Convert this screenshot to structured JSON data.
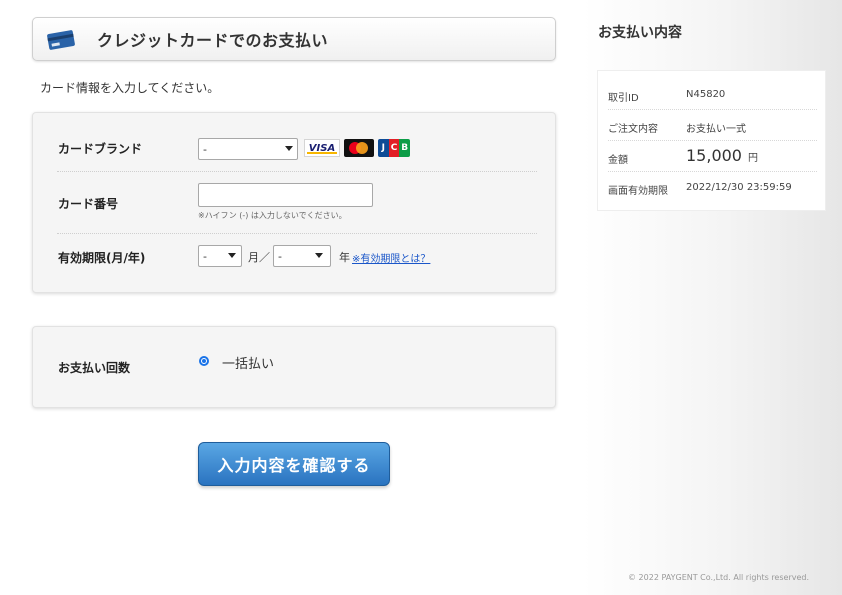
{
  "header": {
    "title": "クレジットカードでのお支払い"
  },
  "instructions": "カード情報を入力してください。",
  "form": {
    "card_brand": {
      "label": "カードブランド",
      "selected": "-"
    },
    "card_number": {
      "label": "カード番号",
      "value": "",
      "hint": "※ハイフン (-) は入力しないでください。"
    },
    "expiry": {
      "label": "有効期限(月/年)",
      "month_selected": "-",
      "month_unit": "月／",
      "year_selected": "-",
      "year_unit": "年",
      "help_link": "※有効期限とは？"
    },
    "installments": {
      "label": "お支払い回数",
      "option_label": "一括払い",
      "selected": true
    },
    "submit_label": "入力内容を確認する"
  },
  "brands": {
    "visa": "VISA",
    "jcb": [
      "J",
      "C",
      "B"
    ]
  },
  "summary": {
    "title": "お支払い内容",
    "rows": [
      {
        "label": "取引ID",
        "value": "N45820"
      },
      {
        "label": "ご注文内容",
        "value": "お支払い一式"
      },
      {
        "label": "金額",
        "value": "15,000",
        "unit": "円"
      },
      {
        "label": "画面有効期限",
        "value": "2022/12/30 23:59:59"
      }
    ]
  },
  "footer": {
    "copyright": "© 2022 PAYGENT Co.,Ltd. All rights reserved."
  },
  "colors": {
    "primary_button": "#2a73c0",
    "link": "#1a56c9",
    "radio": "#1a73e8"
  },
  "icons": {
    "header_icon": "credit-card-icon"
  }
}
